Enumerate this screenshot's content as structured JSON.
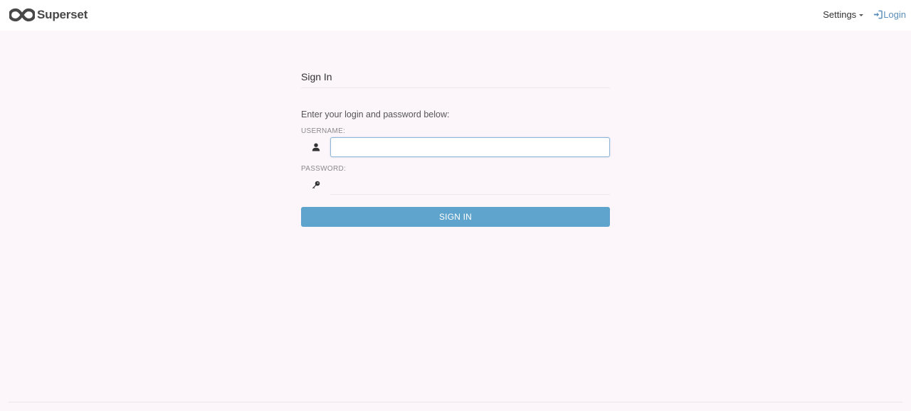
{
  "navbar": {
    "brand": "Superset",
    "settings_label": "Settings",
    "login_label": "Login"
  },
  "panel": {
    "title": "Sign In",
    "instructions": "Enter your login and password below:",
    "username_label": "USERNAME:",
    "username_value": "",
    "password_label": "PASSWORD:",
    "password_value": "",
    "submit_label": "SIGN IN"
  },
  "icons": {
    "logo": "superset-logo-icon",
    "caret": "caret-down-icon",
    "login": "sign-in-icon",
    "user": "user-icon",
    "key": "key-icon"
  },
  "colors": {
    "background": "#fcf6fb",
    "primary_button": "#5fa4cc",
    "link": "#5b8fb9",
    "brand_text": "#484848"
  }
}
